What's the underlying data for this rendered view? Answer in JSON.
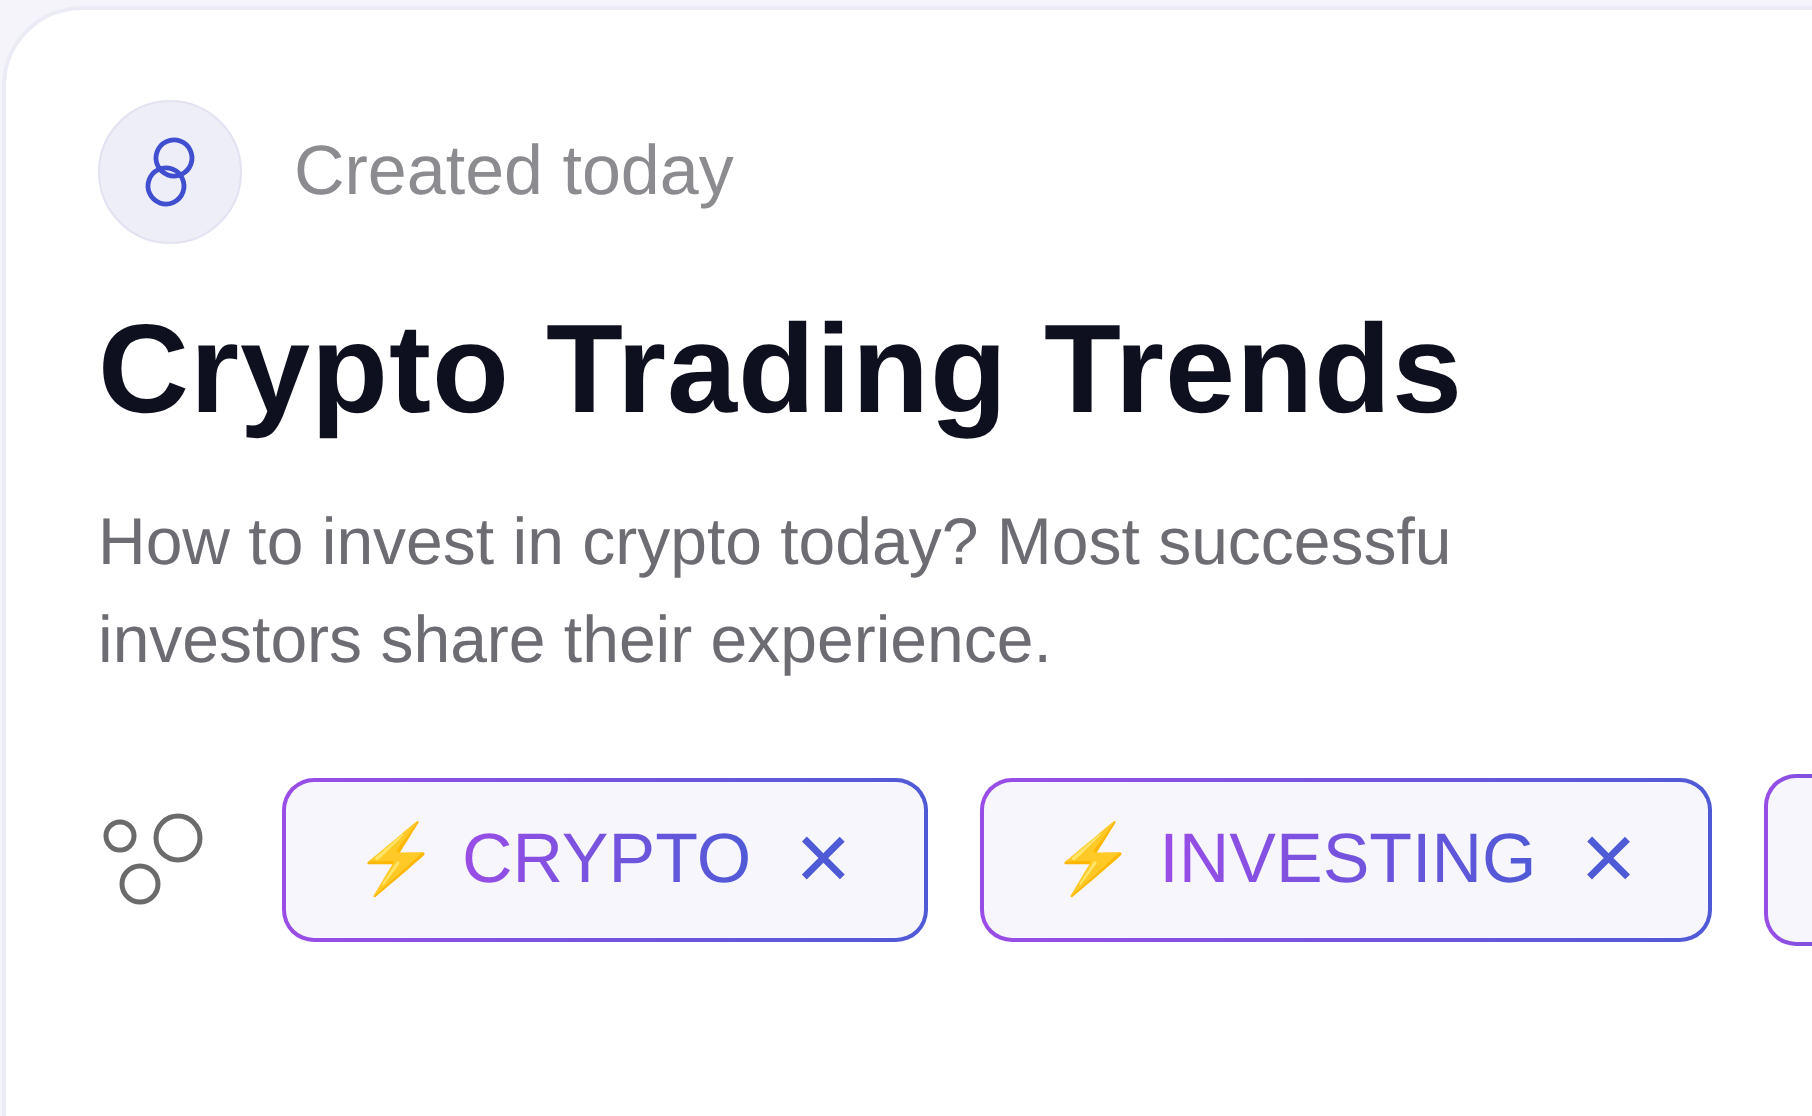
{
  "card": {
    "created": "Created today",
    "title": "Crypto Trading Trends",
    "description": [
      "How to invest in crypto today? Most successfu",
      "investors share their experience."
    ],
    "tags": [
      {
        "label": "CRYPTO",
        "icon": "⚡",
        "remove": "×"
      },
      {
        "label": "INVESTING",
        "icon": "⚡",
        "remove": "×"
      }
    ]
  }
}
